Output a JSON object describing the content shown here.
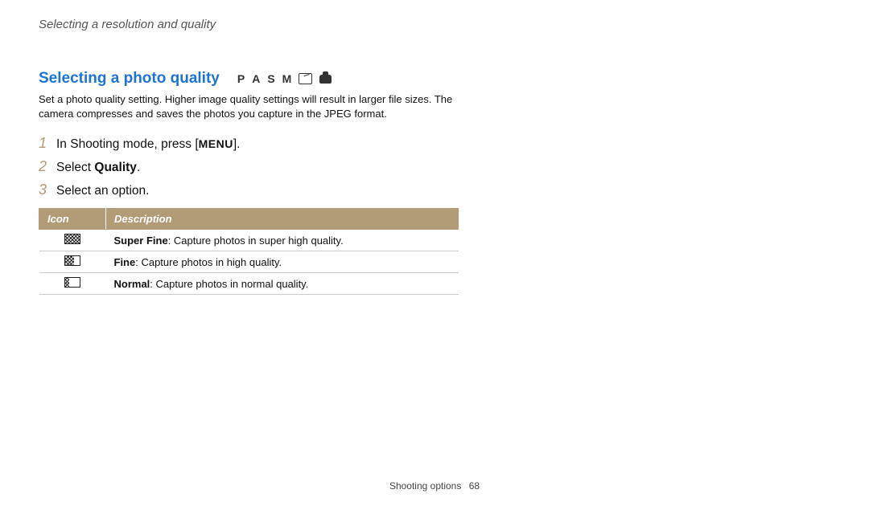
{
  "breadcrumb": "Selecting a resolution and quality",
  "section": {
    "heading": "Selecting a photo quality",
    "modes": [
      "P",
      "A",
      "S",
      "M"
    ],
    "intro": "Set a photo quality setting. Higher image quality settings will result in larger file sizes. The camera compresses and saves the photos you capture in the JPEG format."
  },
  "steps": [
    {
      "num": "1",
      "pre": "In Shooting mode, press [",
      "menu": "MENU",
      "post": "]."
    },
    {
      "num": "2",
      "pre": "Select ",
      "bold": "Quality",
      "post": "."
    },
    {
      "num": "3",
      "pre": "Select an option.",
      "bold": "",
      "post": ""
    }
  ],
  "table": {
    "headers": {
      "icon": "Icon",
      "desc": "Description"
    },
    "rows": [
      {
        "icon": "quality-superfine-icon",
        "bold": "Super Fine",
        "rest": ": Capture photos in super high quality."
      },
      {
        "icon": "quality-fine-icon",
        "bold": "Fine",
        "rest": ": Capture photos in high quality."
      },
      {
        "icon": "quality-normal-icon",
        "bold": "Normal",
        "rest": ": Capture photos in normal quality."
      }
    ]
  },
  "footer": {
    "section": "Shooting options",
    "page": "68"
  }
}
